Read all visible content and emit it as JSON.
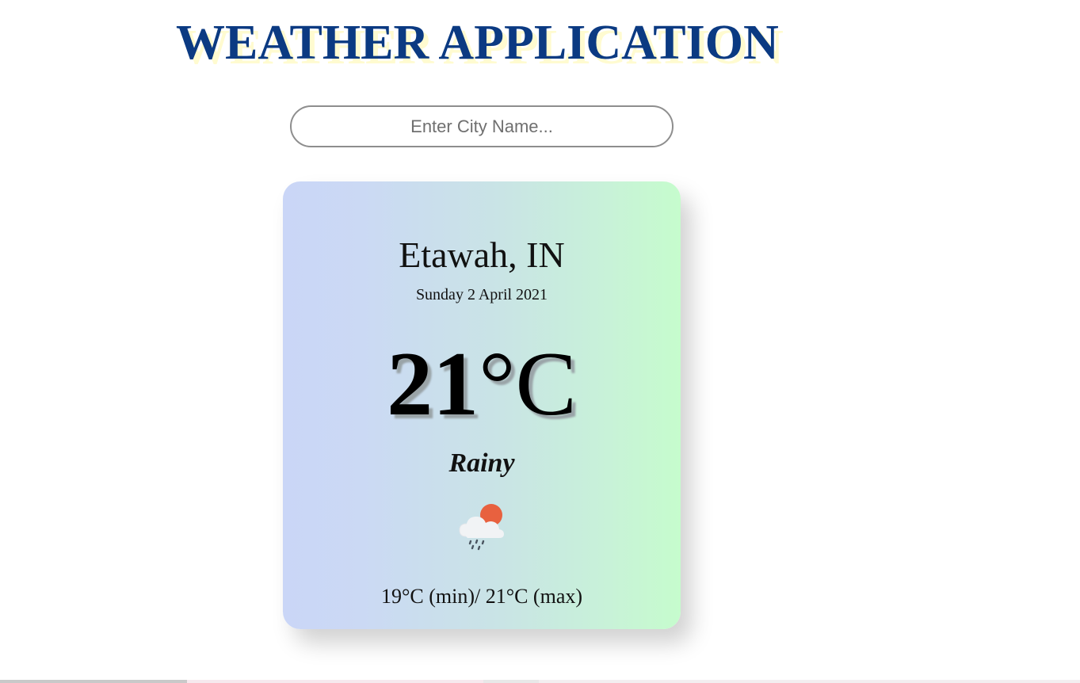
{
  "header": {
    "title": "WEATHER APPLICATION"
  },
  "search": {
    "placeholder": "Enter City Name...",
    "value": ""
  },
  "weather": {
    "location": "Etawah, IN",
    "date": "Sunday 2 April 2021",
    "temperature_value": "21",
    "temperature_unit": "°C",
    "condition": "Rainy",
    "icon": "rain-cloud-sun-icon",
    "min_max": "19°C (min)/ 21°C (max)"
  },
  "colors": {
    "title": "#0b3a82",
    "title_shadow": "#fffbd0",
    "card_gradient_start": "#cad6f7",
    "card_gradient_end": "#c6fccd",
    "sun": "#e8613f"
  }
}
